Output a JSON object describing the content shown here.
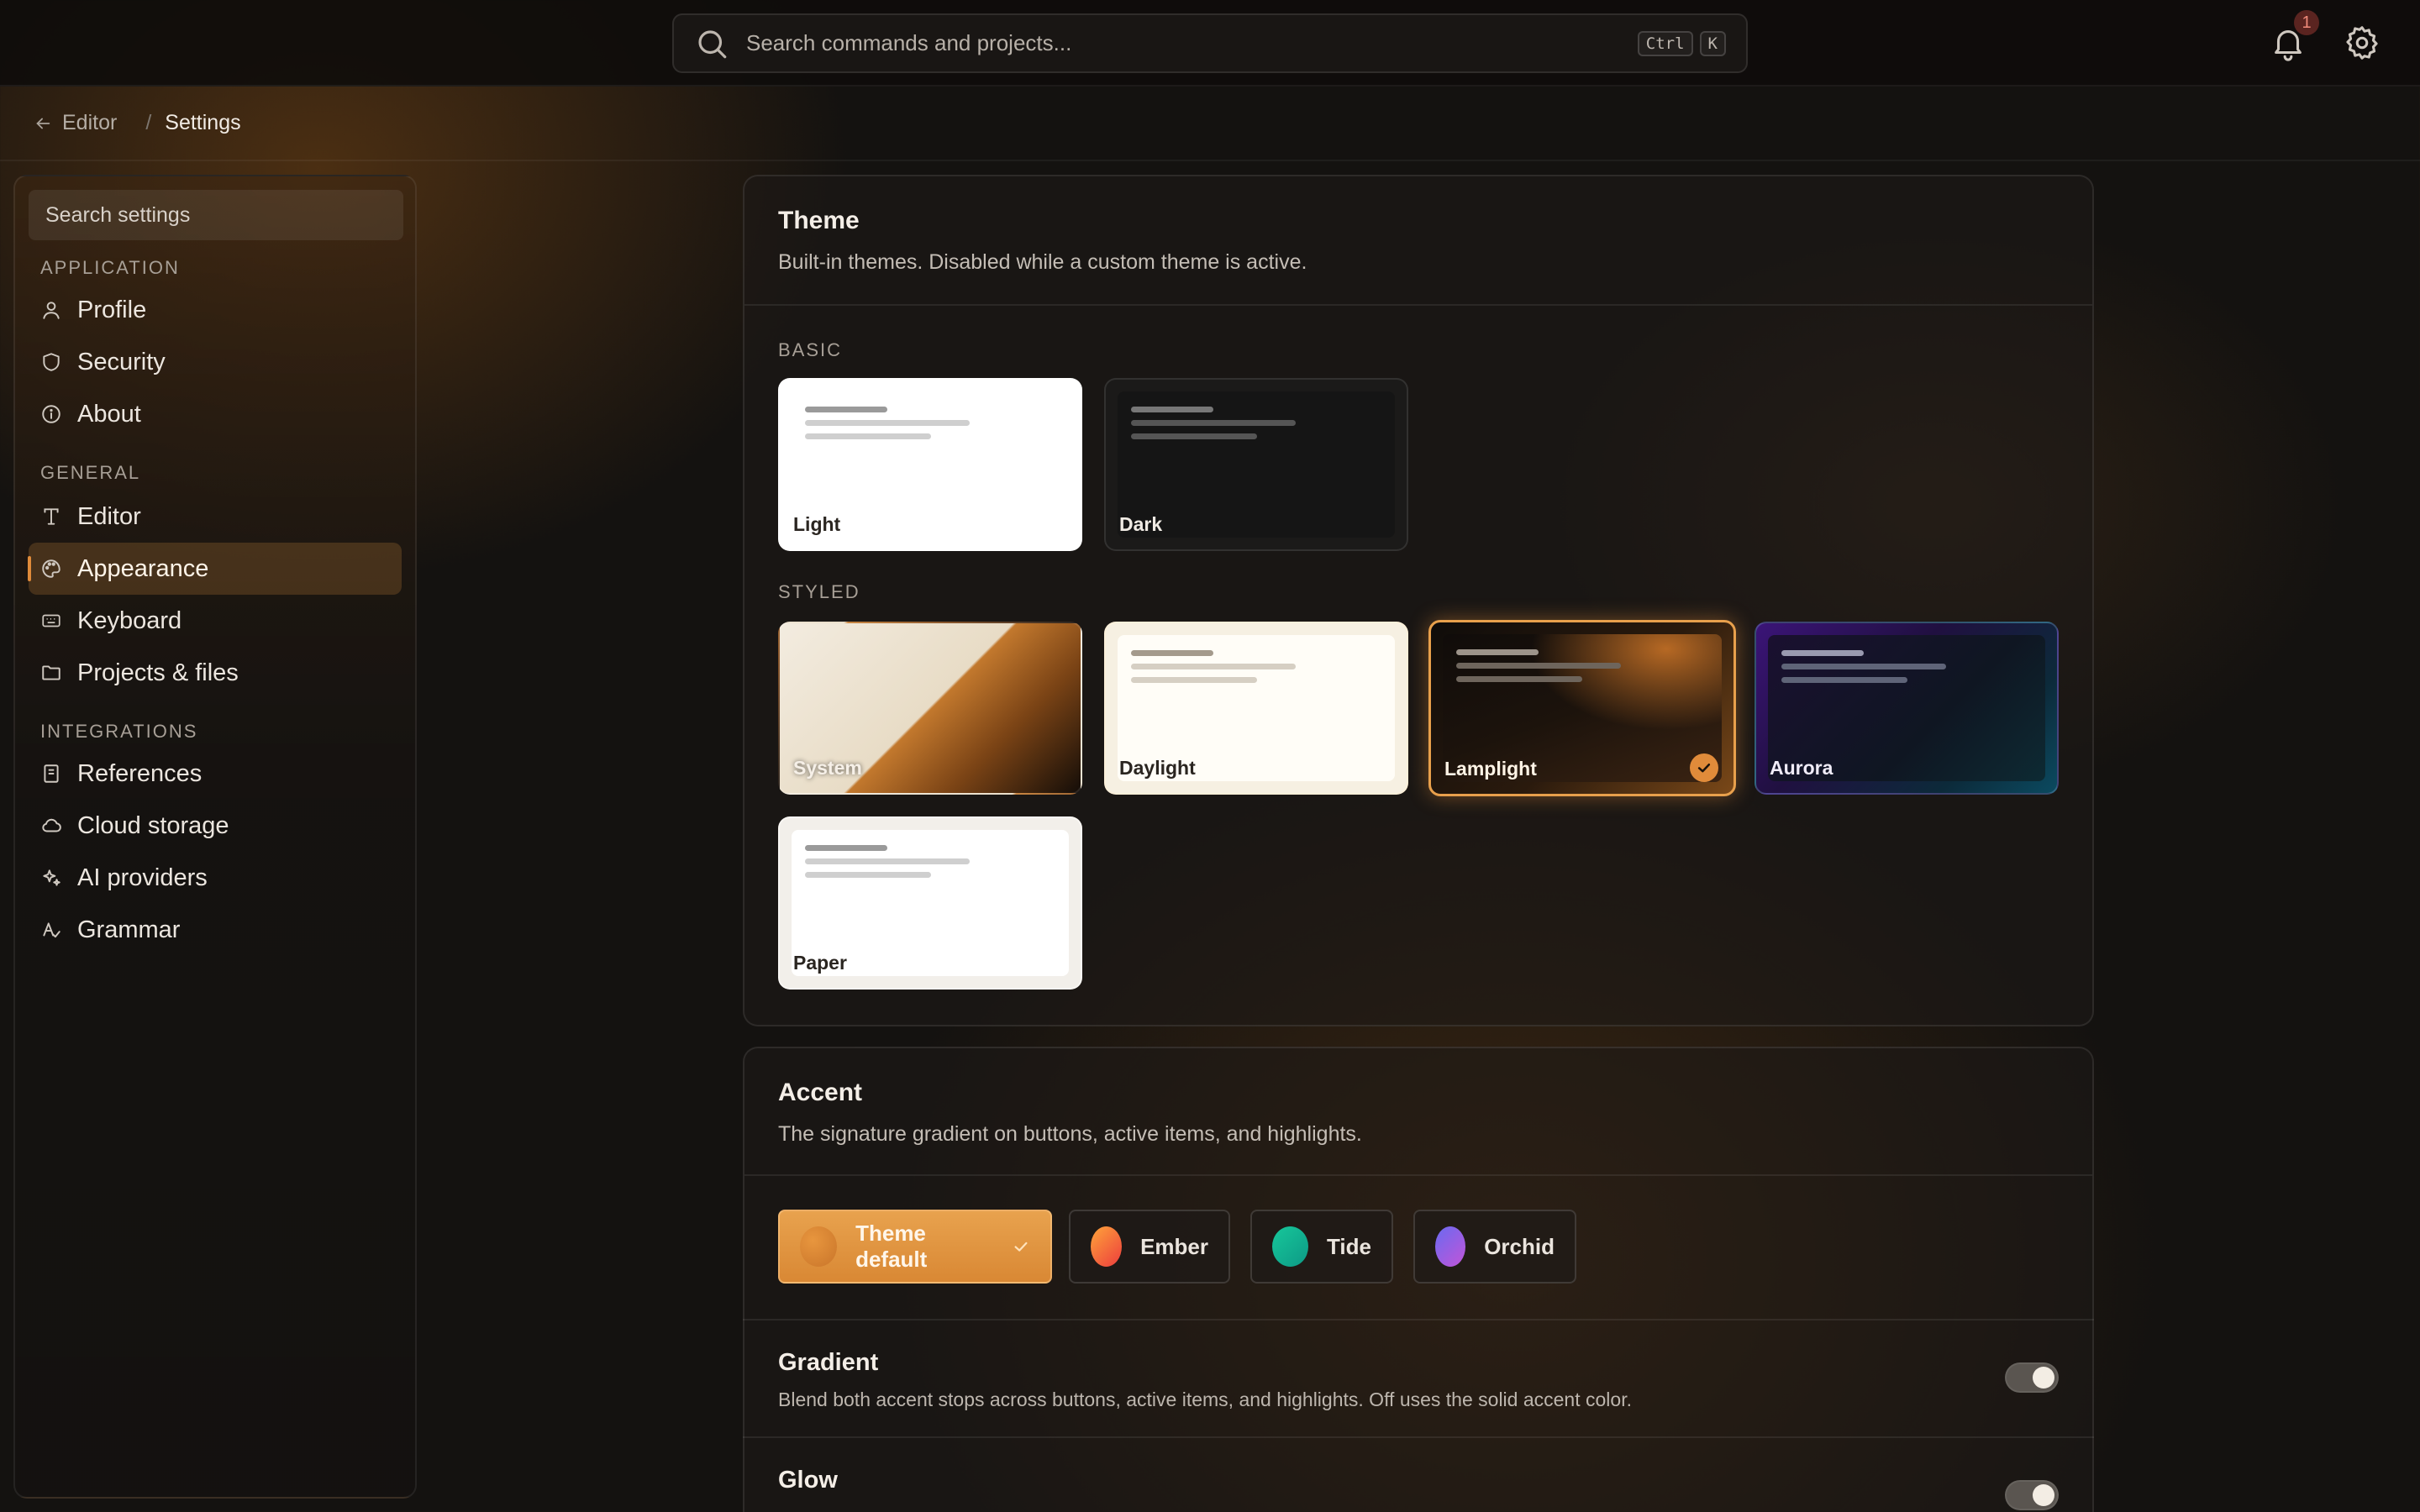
{
  "topbar": {
    "search_placeholder": "Search commands and projects...",
    "shortcut_keys": [
      "Ctrl",
      "K"
    ],
    "notification_count": "1"
  },
  "breadcrumb": {
    "parent": "Editor",
    "separator": "/",
    "current": "Settings"
  },
  "sidebar": {
    "search_placeholder": "Search settings",
    "sections": [
      {
        "heading": "APPLICATION",
        "items": [
          {
            "label": "Profile",
            "icon": "user-icon"
          },
          {
            "label": "Security",
            "icon": "shield-icon"
          },
          {
            "label": "About",
            "icon": "info-icon"
          }
        ]
      },
      {
        "heading": "GENERAL",
        "items": [
          {
            "label": "Editor",
            "icon": "text-icon"
          },
          {
            "label": "Appearance",
            "icon": "palette-icon",
            "active": true
          },
          {
            "label": "Keyboard",
            "icon": "keyboard-icon"
          },
          {
            "label": "Projects & files",
            "icon": "folder-icon"
          }
        ]
      },
      {
        "heading": "INTEGRATIONS",
        "items": [
          {
            "label": "References",
            "icon": "book-icon"
          },
          {
            "label": "Cloud storage",
            "icon": "cloud-icon"
          },
          {
            "label": "AI providers",
            "icon": "sparkles-icon"
          },
          {
            "label": "Grammar",
            "icon": "spellcheck-icon"
          }
        ]
      }
    ]
  },
  "theme": {
    "title": "Theme",
    "description": "Built-in themes. Disabled while a custom theme is active.",
    "basic_label": "BASIC",
    "styled_label": "STYLED",
    "basic": [
      "Light",
      "Dark"
    ],
    "styled": [
      "System",
      "Daylight",
      "Lamplight",
      "Aurora",
      "Paper"
    ],
    "selected": "Lamplight"
  },
  "accent": {
    "title": "Accent",
    "description": "The signature gradient on buttons, active items, and highlights.",
    "options": [
      {
        "label": "Theme default",
        "color": "#d98834",
        "selected": true
      },
      {
        "label": "Ember",
        "color": "#f06a2a"
      },
      {
        "label": "Tide",
        "color": "#14b38f"
      },
      {
        "label": "Orchid",
        "color": "#a05ee0"
      }
    ]
  },
  "gradient": {
    "title": "Gradient",
    "description": "Blend both accent stops across buttons, active items, and highlights. Off uses the solid accent color.",
    "enabled": true
  },
  "glow": {
    "title": "Glow",
    "enabled": true
  },
  "colors": {
    "accent": "#e08b3a",
    "background": "#141210"
  }
}
